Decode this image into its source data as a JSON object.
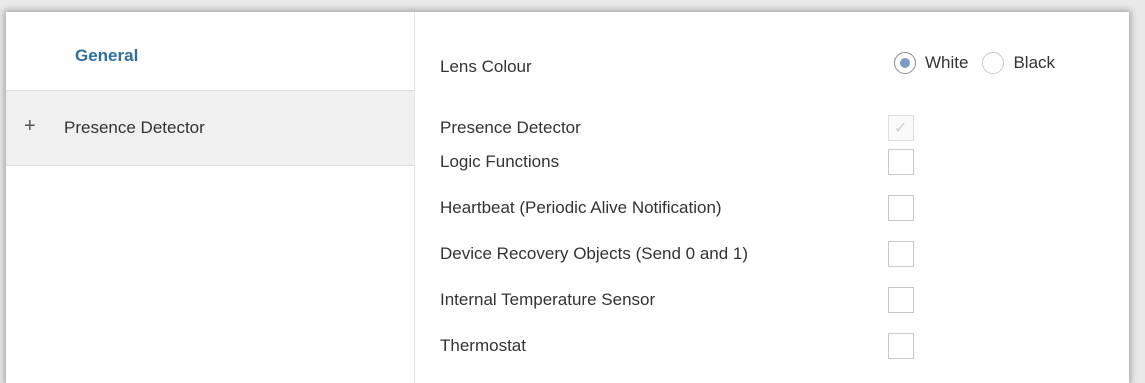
{
  "sidebar": {
    "items": [
      {
        "label": "General"
      },
      {
        "expand_glyph": "+",
        "label": "Presence Detector"
      }
    ]
  },
  "settings": {
    "lens_colour": {
      "label": "Lens Colour",
      "options": [
        "White",
        "Black"
      ],
      "selected": "White"
    },
    "checkboxes": [
      {
        "label": "Presence Detector",
        "checked": true,
        "disabled": true
      },
      {
        "label": "Logic Functions",
        "checked": false
      },
      {
        "label": "Heartbeat (Periodic Alive Notification)",
        "checked": false
      },
      {
        "label": "Device Recovery Objects (Send 0 and 1)",
        "checked": false
      },
      {
        "label": "Internal Temperature Sensor",
        "checked": false
      },
      {
        "label": "Thermostat",
        "checked": false
      }
    ]
  }
}
